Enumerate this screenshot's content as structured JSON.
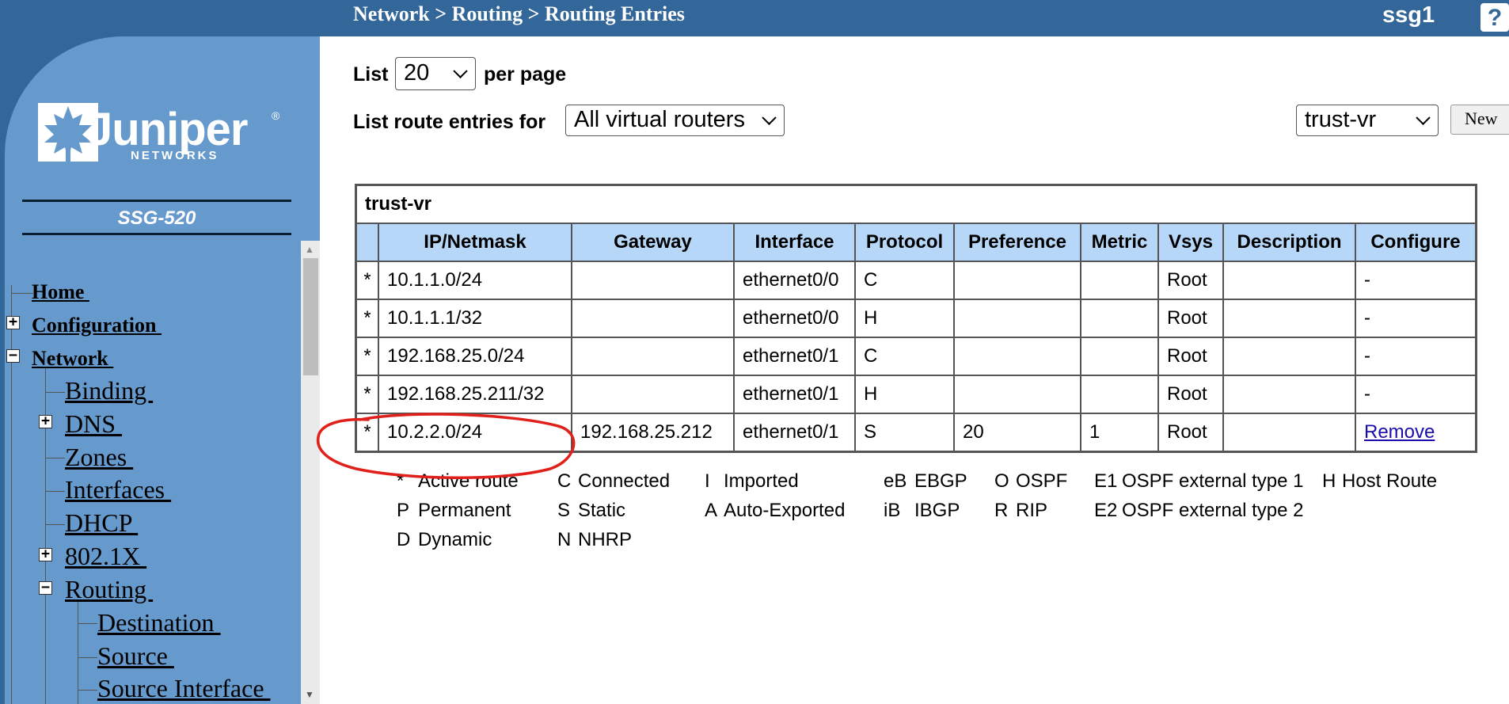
{
  "header": {
    "breadcrumb": "Network > Routing > Routing Entries",
    "device_name": "ssg1",
    "help_label": "?"
  },
  "sidebar": {
    "logo_text": "Juniper",
    "logo_subtext": "NETWORKS",
    "logo_reg": "®",
    "model": "SSG-520",
    "nav": {
      "home": "Home ",
      "configuration": "Configuration ",
      "network": "Network ",
      "binding": "Binding ",
      "dns": "DNS ",
      "zones": "Zones ",
      "interfaces": "Interfaces ",
      "dhcp": "DHCP ",
      "dot1x": "802.1X ",
      "routing": "Routing ",
      "destination": "Destination ",
      "source": "Source ",
      "source_interface": "Source Interface "
    }
  },
  "controls": {
    "list_label": "List",
    "per_page_label": "per page",
    "page_size": "20",
    "route_entries_label": "List route entries for",
    "vr_filter": "All virtual routers",
    "vr_select": "trust-vr",
    "new_button": "New"
  },
  "table": {
    "vr_name": "trust-vr",
    "columns": [
      "IP/Netmask",
      "Gateway",
      "Interface",
      "Protocol",
      "Preference",
      "Metric",
      "Vsys",
      "Description",
      "Configure"
    ],
    "rows": [
      {
        "flag": "*",
        "ip": "10.1.1.0/24",
        "gateway": "",
        "interface": "ethernet0/0",
        "protocol": "C",
        "preference": "",
        "metric": "",
        "vsys": "Root",
        "description": "",
        "configure": "-"
      },
      {
        "flag": "*",
        "ip": "10.1.1.1/32",
        "gateway": "",
        "interface": "ethernet0/0",
        "protocol": "H",
        "preference": "",
        "metric": "",
        "vsys": "Root",
        "description": "",
        "configure": "-"
      },
      {
        "flag": "*",
        "ip": "192.168.25.0/24",
        "gateway": "",
        "interface": "ethernet0/1",
        "protocol": "C",
        "preference": "",
        "metric": "",
        "vsys": "Root",
        "description": "",
        "configure": "-"
      },
      {
        "flag": "*",
        "ip": "192.168.25.211/32",
        "gateway": "",
        "interface": "ethernet0/1",
        "protocol": "H",
        "preference": "",
        "metric": "",
        "vsys": "Root",
        "description": "",
        "configure": "-"
      },
      {
        "flag": "*",
        "ip": "10.2.2.0/24",
        "gateway": "192.168.25.212",
        "interface": "ethernet0/1",
        "protocol": "S",
        "preference": "20",
        "metric": "1",
        "vsys": "Root",
        "description": "",
        "configure": "Remove"
      }
    ]
  },
  "legend": {
    "row1": [
      {
        "code": "*",
        "text": "Active route"
      },
      {
        "code": "C",
        "text": "Connected"
      },
      {
        "code": "I",
        "text": "Imported"
      },
      {
        "code": "eB",
        "text": "EBGP"
      },
      {
        "code": "O",
        "text": "OSPF"
      },
      {
        "code": "E1",
        "text": "OSPF external type 1"
      },
      {
        "code": "H",
        "text": "Host Route"
      }
    ],
    "row2": [
      {
        "code": "P",
        "text": "Permanent"
      },
      {
        "code": "S",
        "text": "Static"
      },
      {
        "code": "A",
        "text": "Auto-Exported"
      },
      {
        "code": "iB",
        "text": "IBGP"
      },
      {
        "code": "R",
        "text": "RIP"
      },
      {
        "code": "E2",
        "text": "OSPF external type 2"
      }
    ],
    "row3": [
      {
        "code": "D",
        "text": "Dynamic"
      },
      {
        "code": "N",
        "text": "NHRP"
      }
    ]
  },
  "colors": {
    "header_bg": "#336699",
    "sidebar_bg": "#6699cc",
    "table_header_bg": "#b6d7f7",
    "annotation": "#e0201b"
  }
}
